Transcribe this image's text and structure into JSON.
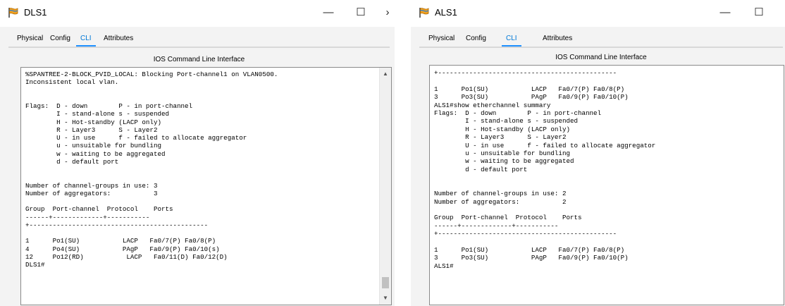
{
  "dls": {
    "title": "DLS1",
    "minimize": "—",
    "maximize": "☐",
    "close": "›",
    "tabs": [
      "Physical",
      "Config",
      "CLI",
      "Attributes"
    ],
    "cli_header": "IOS Command Line Interface",
    "terminal_text": "%SPANTREE-2-BLOCK_PVID_LOCAL: Blocking Port-channel1 on VLAN0500.\nInconsistent local vlan.\n\n\nFlags:  D - down        P - in port-channel\n        I - stand-alone s - suspended\n        H - Hot-standby (LACP only)\n        R - Layer3      S - Layer2\n        U - in use      f - failed to allocate aggregator\n        u - unsuitable for bundling\n        w - waiting to be aggregated\n        d - default port\n\n\nNumber of channel-groups in use: 3\nNumber of aggregators:           3\n\nGroup  Port-channel  Protocol    Ports\n------+-------------+-----------\n+----------------------------------------------\n\n1      Po1(SU)           LACP   Fa0/7(P) Fa0/8(P)\n4      Po4(SU)           PAgP   Fa0/9(P) Fa0/10(s)\n12     Po12(RD)           LACP   Fa0/11(D) Fa0/12(D)\nDLS1#"
  },
  "als": {
    "title": "ALS1",
    "minimize": "—",
    "maximize": "☐",
    "tabs": [
      "Physical",
      "Config",
      "CLI",
      "Attributes"
    ],
    "cli_header": "IOS Command Line Interface",
    "terminal_text": "+----------------------------------------------\n\n1      Po1(SU)           LACP   Fa0/7(P) Fa0/8(P)\n3      Po3(SU)           PAgP   Fa0/9(P) Fa0/10(P)\nALS1#show etherchannel summary\nFlags:  D - down        P - in port-channel\n        I - stand-alone s - suspended\n        H - Hot-standby (LACP only)\n        R - Layer3      S - Layer2\n        U - in use      f - failed to allocate aggregator\n        u - unsuitable for bundling\n        w - waiting to be aggregated\n        d - default port\n\n\nNumber of channel-groups in use: 2\nNumber of aggregators:           2\n\nGroup  Port-channel  Protocol    Ports\n------+-------------+-----------\n+----------------------------------------------\n\n1      Po1(SU)           LACP   Fa0/7(P) Fa0/8(P)\n3      Po3(SU)           PAgP   Fa0/9(P) Fa0/10(P)\nALS1#"
  }
}
